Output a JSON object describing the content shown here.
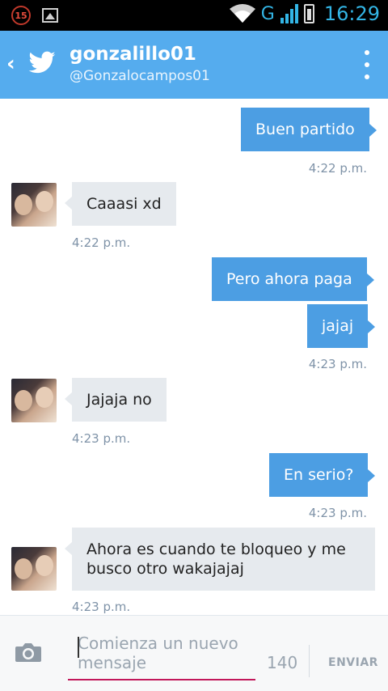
{
  "status_bar": {
    "notification_count": "15",
    "network_type": "G",
    "time": "16:29"
  },
  "header": {
    "name": "gonzalillo01",
    "handle": "@Gonzalocampos01"
  },
  "messages": [
    {
      "dir": "out",
      "text": "Buen partido",
      "time": "4:22 p.m."
    },
    {
      "dir": "in",
      "text": "Caaasi xd",
      "time": "4:22 p.m."
    },
    {
      "dir": "out",
      "text": "Pero ahora paga",
      "time": ""
    },
    {
      "dir": "out",
      "text": "jajaj",
      "time": "4:23 p.m."
    },
    {
      "dir": "in",
      "text": "Jajaja no",
      "time": "4:23 p.m."
    },
    {
      "dir": "out",
      "text": "En serio?",
      "time": "4:23 p.m."
    },
    {
      "dir": "in",
      "text": "Ahora es cuando te bloqueo y me busco otro wakajajaj",
      "time": "4:23 p.m."
    }
  ],
  "composer": {
    "placeholder": "Comienza un nuevo mensaje",
    "char_count": "140",
    "send_label": "ENVIAR"
  },
  "colors": {
    "header": "#55acee",
    "outgoing_bubble": "#4c9ee3",
    "incoming_bubble": "#e6eaee",
    "input_underline": "#c2185b"
  }
}
